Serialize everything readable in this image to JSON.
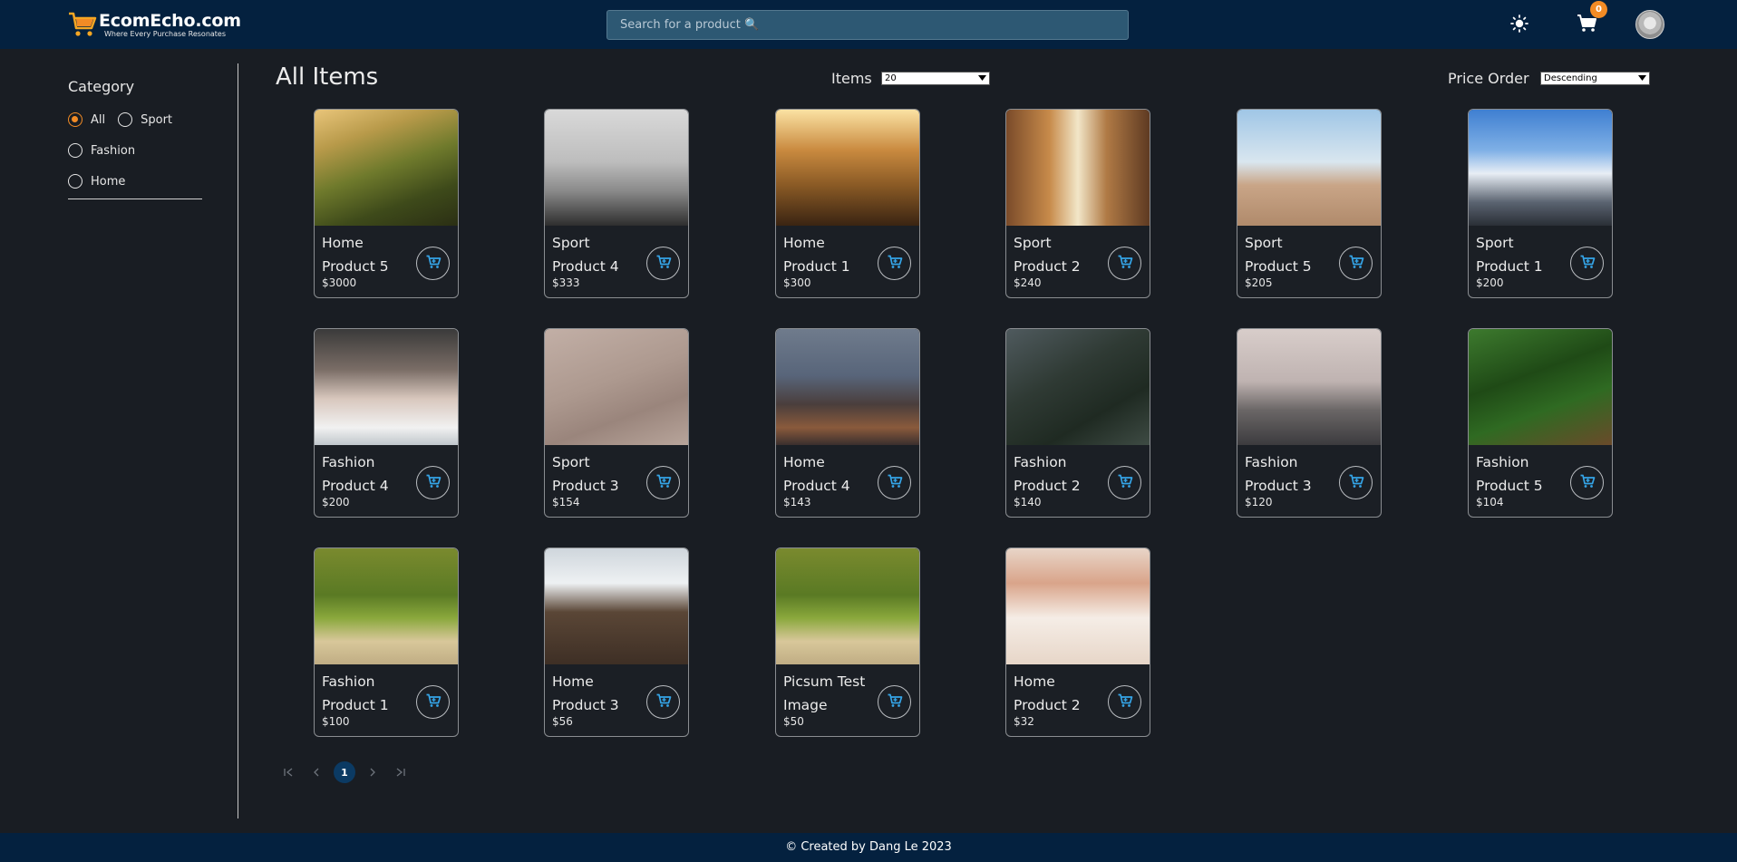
{
  "header": {
    "logo_title": "EcomEcho.com",
    "logo_subtitle": "Where Every Purchase Resonates",
    "search_placeholder": "Search for a product 🔍",
    "cart_count": "0",
    "colors": {
      "bar": "#04213f",
      "accent": "#f28b25"
    }
  },
  "sidebar": {
    "title": "Category",
    "options": [
      {
        "label": "All",
        "checked": true
      },
      {
        "label": "Sport",
        "checked": false
      },
      {
        "label": "Fashion",
        "checked": false
      },
      {
        "label": "Home",
        "checked": false
      }
    ]
  },
  "toolbar": {
    "title": "All Items",
    "items_label": "Items",
    "items_value": "20",
    "price_label": "Price Order",
    "price_value": "Descending"
  },
  "products": [
    {
      "name": "Home Product 5",
      "price": "$3000",
      "image": "mountain-valley"
    },
    {
      "name": "Sport Product 4",
      "price": "$333",
      "image": "eiffel-tower-bw"
    },
    {
      "name": "Home Product 1",
      "price": "$300",
      "image": "desert-car-sunset"
    },
    {
      "name": "Sport Product 2",
      "price": "$240",
      "image": "narrow-street"
    },
    {
      "name": "Sport Product 5",
      "price": "$205",
      "image": "beach-couple"
    },
    {
      "name": "Sport Product 1",
      "price": "$200",
      "image": "snowy-mountains"
    },
    {
      "name": "Fashion Product 4",
      "price": "$200",
      "image": "hand-on-device"
    },
    {
      "name": "Sport Product 3",
      "price": "$154",
      "image": "footprint-sand"
    },
    {
      "name": "Home Product 4",
      "price": "$143",
      "image": "foggy-road-night"
    },
    {
      "name": "Fashion Product 2",
      "price": "$140",
      "image": "moss-rocks"
    },
    {
      "name": "Fashion Product 3",
      "price": "$120",
      "image": "misty-sea"
    },
    {
      "name": "Fashion Product 5",
      "price": "$104",
      "image": "green-beans"
    },
    {
      "name": "Fashion Product 1",
      "price": "$100",
      "image": "grass-dune"
    },
    {
      "name": "Home Product 3",
      "price": "$56",
      "image": "keyboard-tablet"
    },
    {
      "name": "Picsum Test Image",
      "price": "$50",
      "image": "grass-dune"
    },
    {
      "name": "Home Product 2",
      "price": "$32",
      "image": "desk-workspace"
    }
  ],
  "pagination": {
    "current_page": "1",
    "controls": [
      "first-page",
      "previous-page",
      "next-page",
      "last-page"
    ]
  },
  "footer": {
    "text": "© Created by Dang Le 2023"
  }
}
